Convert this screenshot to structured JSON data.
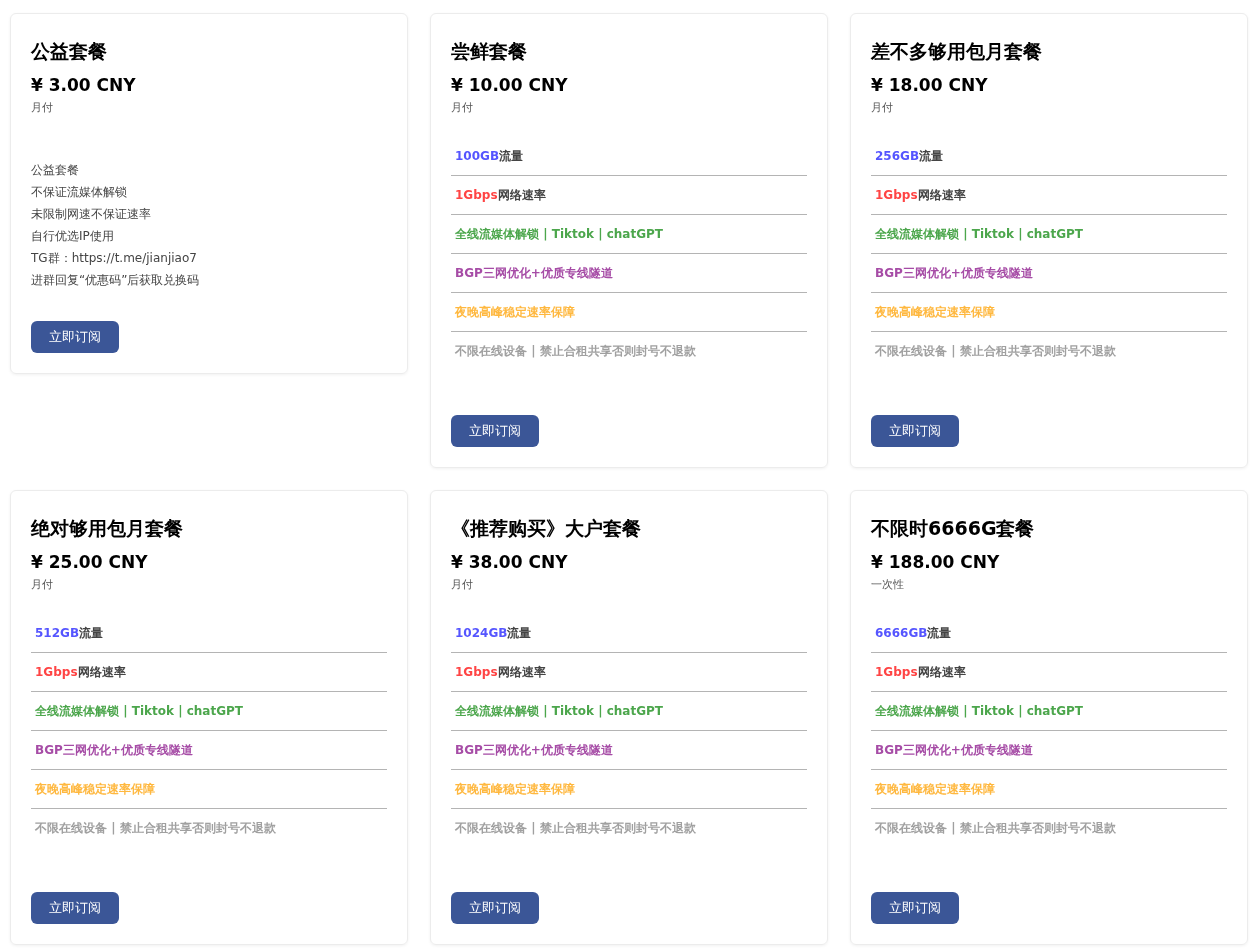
{
  "plans": [
    {
      "name": "公益套餐",
      "price": "¥ 3.00 CNY",
      "period": "月付",
      "kind": "description",
      "description": [
        "公益套餐",
        "不保证流媒体解锁",
        "未限制网速不保证速率",
        "自行优选IP使用",
        "TG群：https://t.me/jianjiao7",
        "进群回复“优惠码”后获取兑换码"
      ],
      "button": "立即订阅"
    },
    {
      "name": "尝鲜套餐",
      "price": "¥ 10.00 CNY",
      "period": "月付",
      "kind": "features",
      "features": [
        {
          "highlight": "100GB",
          "rest": "流量",
          "color": "#5555ff"
        },
        {
          "highlight": "1Gbps",
          "rest": "网络速率",
          "color": "#ff4444"
        },
        {
          "highlight": "全线流媒体解锁 | Tiktok | chatGPT",
          "color": "#4ca64c"
        },
        {
          "highlight": "BGP三网优化+优质专线隧道",
          "color": "#a64ca6"
        },
        {
          "highlight": "夜晚高峰稳定速率保障",
          "color": "#ffb83f"
        },
        {
          "highlight": "不限在线设备 | 禁止合租共享否则封号不退款",
          "color": "#a0a0a0"
        }
      ],
      "button": "立即订阅"
    },
    {
      "name": "差不多够用包月套餐",
      "price": "¥ 18.00 CNY",
      "period": "月付",
      "kind": "features",
      "features": [
        {
          "highlight": "256GB",
          "rest": "流量",
          "color": "#5555ff"
        },
        {
          "highlight": "1Gbps",
          "rest": "网络速率",
          "color": "#ff4444"
        },
        {
          "highlight": "全线流媒体解锁 | Tiktok | chatGPT",
          "color": "#4ca64c"
        },
        {
          "highlight": "BGP三网优化+优质专线隧道",
          "color": "#a64ca6"
        },
        {
          "highlight": "夜晚高峰稳定速率保障",
          "color": "#ffb83f"
        },
        {
          "highlight": "不限在线设备 | 禁止合租共享否则封号不退款",
          "color": "#a0a0a0"
        }
      ],
      "button": "立即订阅"
    },
    {
      "name": "绝对够用包月套餐",
      "price": "¥ 25.00 CNY",
      "period": "月付",
      "kind": "features",
      "features": [
        {
          "highlight": "512GB",
          "rest": "流量",
          "color": "#5555ff"
        },
        {
          "highlight": "1Gbps",
          "rest": "网络速率",
          "color": "#ff4444"
        },
        {
          "highlight": "全线流媒体解锁 | Tiktok | chatGPT",
          "color": "#4ca64c"
        },
        {
          "highlight": "BGP三网优化+优质专线隧道",
          "color": "#a64ca6"
        },
        {
          "highlight": "夜晚高峰稳定速率保障",
          "color": "#ffb83f"
        },
        {
          "highlight": "不限在线设备 | 禁止合租共享否则封号不退款",
          "color": "#a0a0a0"
        }
      ],
      "button": "立即订阅"
    },
    {
      "name": "《推荐购买》大户套餐",
      "price": "¥ 38.00 CNY",
      "period": "月付",
      "kind": "features",
      "features": [
        {
          "highlight": "1024GB",
          "rest": "流量",
          "color": "#5555ff"
        },
        {
          "highlight": "1Gbps",
          "rest": "网络速率",
          "color": "#ff4444"
        },
        {
          "highlight": "全线流媒体解锁 | Tiktok | chatGPT",
          "color": "#4ca64c"
        },
        {
          "highlight": "BGP三网优化+优质专线隧道",
          "color": "#a64ca6"
        },
        {
          "highlight": "夜晚高峰稳定速率保障",
          "color": "#ffb83f"
        },
        {
          "highlight": "不限在线设备 | 禁止合租共享否则封号不退款",
          "color": "#a0a0a0"
        }
      ],
      "button": "立即订阅"
    },
    {
      "name": "不限时6666G套餐",
      "price": "¥ 188.00 CNY",
      "period": "一次性",
      "kind": "features",
      "features": [
        {
          "highlight": "6666GB",
          "rest": "流量",
          "color": "#5555ff"
        },
        {
          "highlight": "1Gbps",
          "rest": "网络速率",
          "color": "#ff4444"
        },
        {
          "highlight": "全线流媒体解锁 | Tiktok | chatGPT",
          "color": "#4ca64c"
        },
        {
          "highlight": "BGP三网优化+优质专线隧道",
          "color": "#a64ca6"
        },
        {
          "highlight": "夜晚高峰稳定速率保障",
          "color": "#ffb83f"
        },
        {
          "highlight": "不限在线设备 | 禁止合租共享否则封号不退款",
          "color": "#a0a0a0"
        }
      ],
      "button": "立即订阅"
    }
  ]
}
